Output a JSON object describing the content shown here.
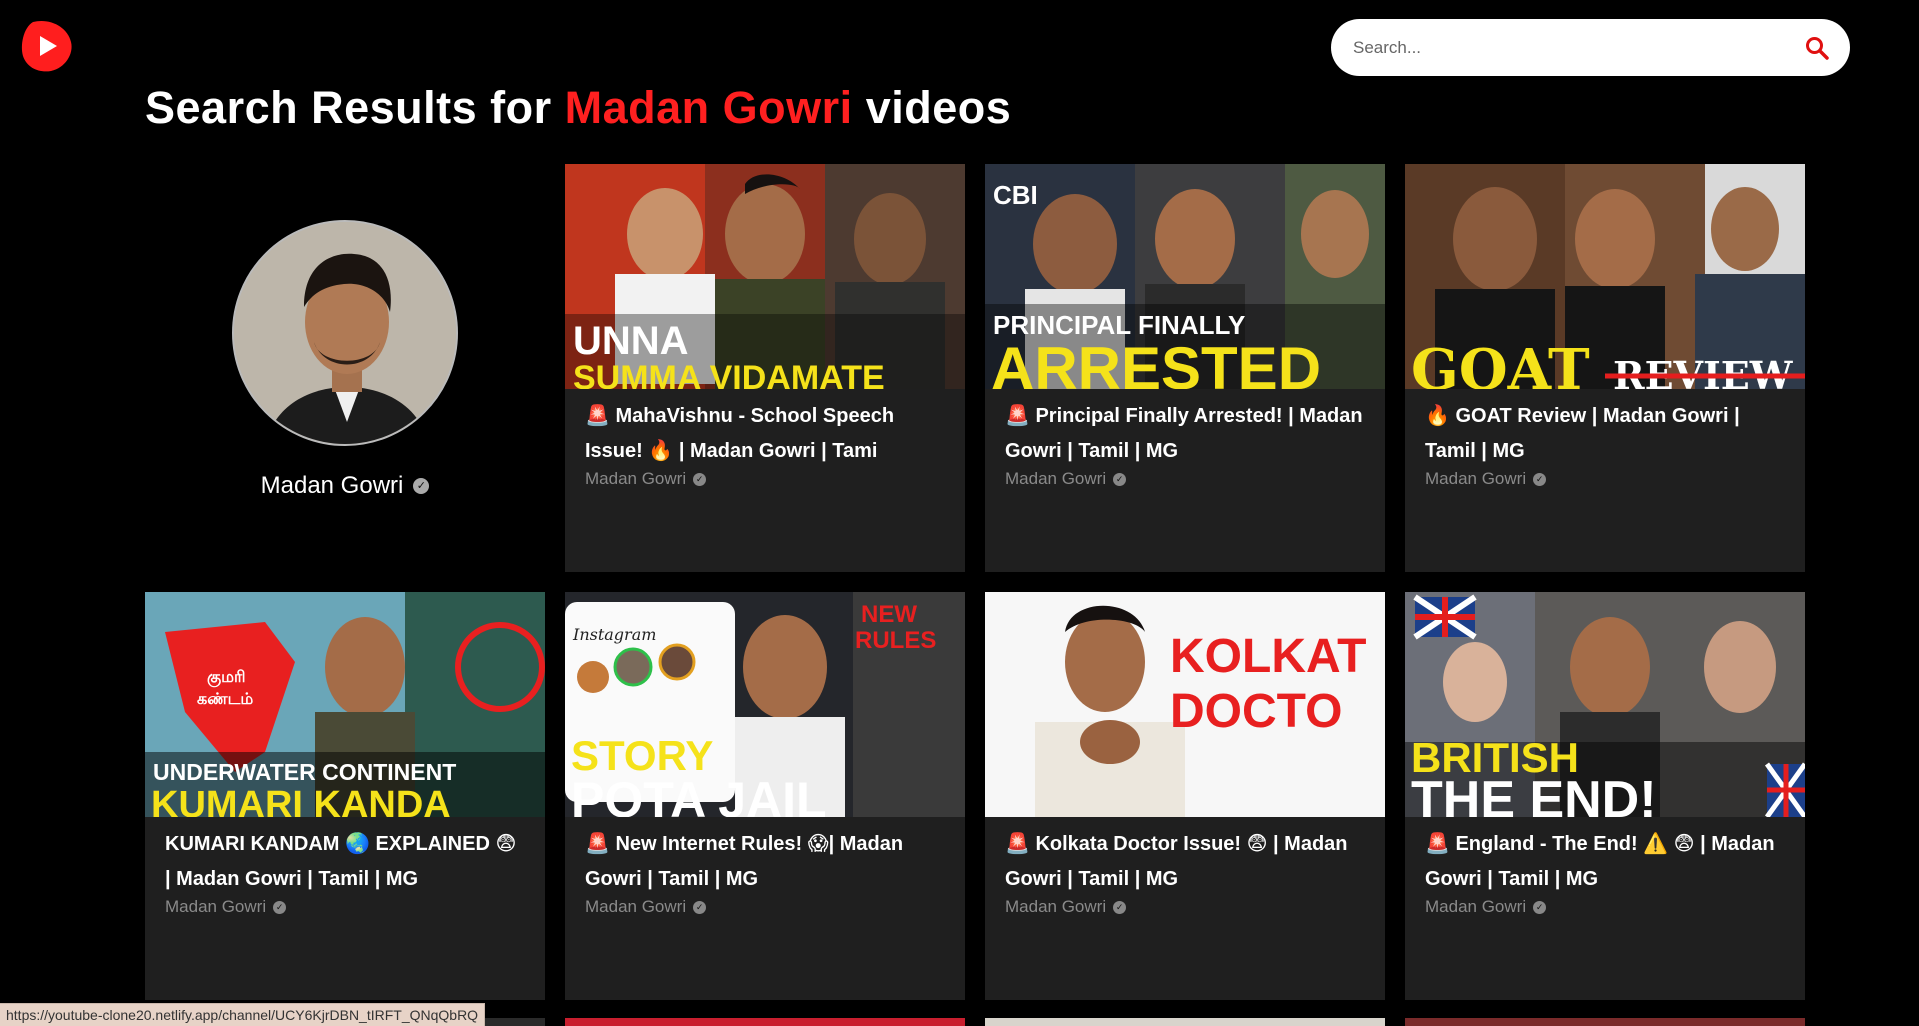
{
  "app": {
    "logo_icon": "youtube-play-icon",
    "accent": "#ff2020"
  },
  "search": {
    "placeholder": "Search...",
    "icon": "search-icon"
  },
  "heading": {
    "prefix": "Search Results for ",
    "query": "Madan Gowri",
    "suffix": " videos"
  },
  "channel": {
    "name": "Madan Gowri",
    "verified": "✓"
  },
  "videos": [
    {
      "title": "🚨 MahaVishnu - School Speech Issue! 🔥 | Madan Gowri | Tami",
      "channel": "Madan Gowri",
      "thumb_text_1": "UNNA",
      "thumb_text_2": "SUMMA VIDAMATE"
    },
    {
      "title": "🚨 Principal Finally Arrested! | Madan Gowri | Tamil | MG",
      "channel": "Madan Gowri",
      "thumb_text_1": "PRINCIPAL FINALLY",
      "thumb_text_2": "ARRESTED"
    },
    {
      "title": "🔥 GOAT Review | Madan Gowri | Tamil | MG",
      "channel": "Madan Gowri",
      "thumb_text_1": "GOAT",
      "thumb_text_2": "REVIEW"
    },
    {
      "title": "KUMARI KANDAM 🌏 EXPLAINED 😨 | Madan Gowri | Tamil | MG",
      "channel": "Madan Gowri",
      "thumb_text_1": "UNDERWATER CONTINENT",
      "thumb_text_2": "KUMARI KANDA"
    },
    {
      "title": "🚨 New Internet Rules! 😱| Madan Gowri | Tamil | MG",
      "channel": "Madan Gowri",
      "thumb_text_1": "STORY",
      "thumb_text_2": "POTA JAIL"
    },
    {
      "title": "🚨 Kolkata Doctor Issue! 😨 | Madan Gowri | Tamil | MG",
      "channel": "Madan Gowri",
      "thumb_text_1": "KOLKAT",
      "thumb_text_2": "DOCTO"
    },
    {
      "title": "🚨 England - The End! ⚠️ 😨 | Madan Gowri | Tamil | MG",
      "channel": "Madan Gowri",
      "thumb_text_1": "BRITISH",
      "thumb_text_2": "THE END!"
    }
  ],
  "status_bar": {
    "url": "https://youtube-clone20.netlify.app/channel/UCY6KjrDBN_tIRFT_QNqQbRQ"
  }
}
